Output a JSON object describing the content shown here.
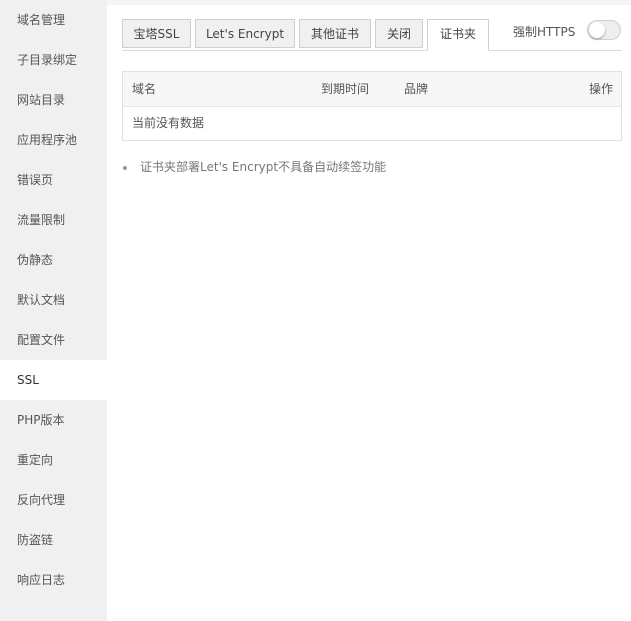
{
  "sidebar": {
    "items": [
      {
        "label": "域名管理"
      },
      {
        "label": "子目录绑定"
      },
      {
        "label": "网站目录"
      },
      {
        "label": "应用程序池"
      },
      {
        "label": "错误页"
      },
      {
        "label": "流量限制"
      },
      {
        "label": "伪静态"
      },
      {
        "label": "默认文档"
      },
      {
        "label": "配置文件"
      },
      {
        "label": "SSL"
      },
      {
        "label": "PHP版本"
      },
      {
        "label": "重定向"
      },
      {
        "label": "反向代理"
      },
      {
        "label": "防盗链"
      },
      {
        "label": "响应日志"
      }
    ],
    "active": "SSL"
  },
  "tabs": [
    {
      "label": "宝塔SSL"
    },
    {
      "label": "Let's Encrypt"
    },
    {
      "label": "其他证书"
    },
    {
      "label": "关闭"
    },
    {
      "label": "证书夹"
    }
  ],
  "active_tab": "证书夹",
  "https_toggle": {
    "label": "强制HTTPS",
    "enabled": false
  },
  "table": {
    "columns": [
      "域名",
      "到期时间",
      "品牌",
      "操作"
    ],
    "empty_text": "当前没有数据"
  },
  "notes": [
    "证书夹部署Let's Encrypt不具备自动续签功能"
  ]
}
